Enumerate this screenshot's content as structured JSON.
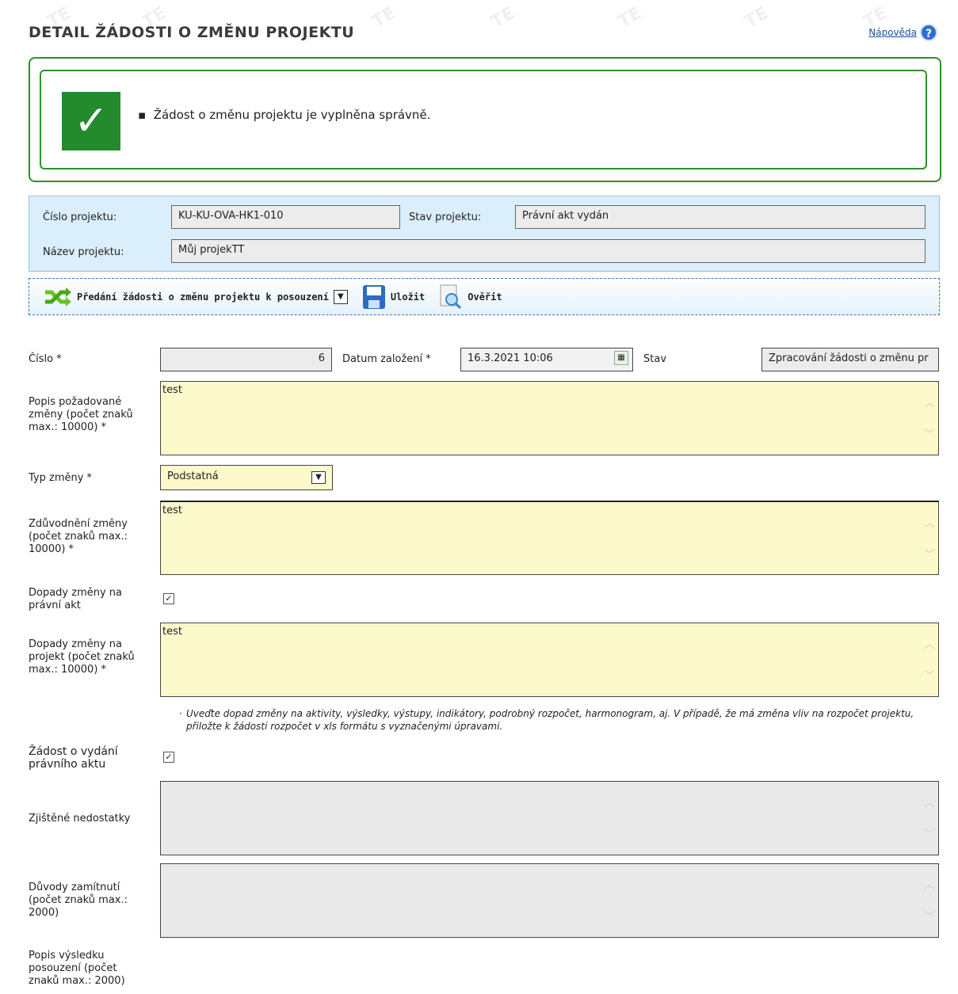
{
  "page": {
    "title": "DETAIL ŽÁDOSTI O ZMĚNU PROJEKTU",
    "help_link": "Nápověda",
    "help_icon": "question-icon"
  },
  "success": {
    "icon": "check-icon",
    "message": "Žádost o změnu projektu je vyplněna správně."
  },
  "project": {
    "number_label": "Číslo projektu:",
    "number_value": "KU-KU-OVA-HK1-010",
    "state_label": "Stav projektu:",
    "state_value": "Právní akt vydán",
    "name_label": "Název projektu:",
    "name_value": "Můj projekTT"
  },
  "toolbar": {
    "handover_label": "Předání žádosti o změnu projektu k posouzení",
    "save_label": "Uložit",
    "verify_label": "Ověřit"
  },
  "form": {
    "number_label": "Číslo *",
    "number_value": "6",
    "created_label": "Datum založení *",
    "created_value": "16.3.2021 10:06",
    "state_label": "Stav",
    "state_value": "Zpracování žádosti o změnu pr",
    "description_label": "Popis požadované změny (počet znaků max.: 10000) *",
    "description_value": "test",
    "type_label": "Typ změny *",
    "type_value": "Podstatná",
    "justification_label": "Zdůvodnění změny (počet znaků max.: 10000) *",
    "justification_value": "test",
    "legal_impact_label": "Dopady změny na právní akt",
    "legal_impact_checked": true,
    "project_impact_label": "Dopady změny na projekt (počet znaků max.: 10000) *",
    "project_impact_value": "test",
    "hint": "Uveďte dopad změny na aktivity, výsledky, výstupy, indikátory, podrobný rozpočet, harmonogram, aj. V případě, že má změna vliv na rozpočet projektu, přiložte k žádosti rozpočet v xls formátu s vyznačenými úpravami.",
    "legal_request_label": "Žádost o vydání právního aktu",
    "legal_request_checked": true,
    "deficiencies_label": "Zjištěné nedostatky",
    "deficiencies_value": "",
    "rejection_label": "Důvody zamítnutí (počet znaků max.: 2000)",
    "rejection_value": "",
    "result_label": "Popis výsledku posouzení (počet znaků max.: 2000)"
  },
  "colors": {
    "success": "#238b2c",
    "panel": "#dbeefb",
    "required_field": "#fcf9cb"
  }
}
